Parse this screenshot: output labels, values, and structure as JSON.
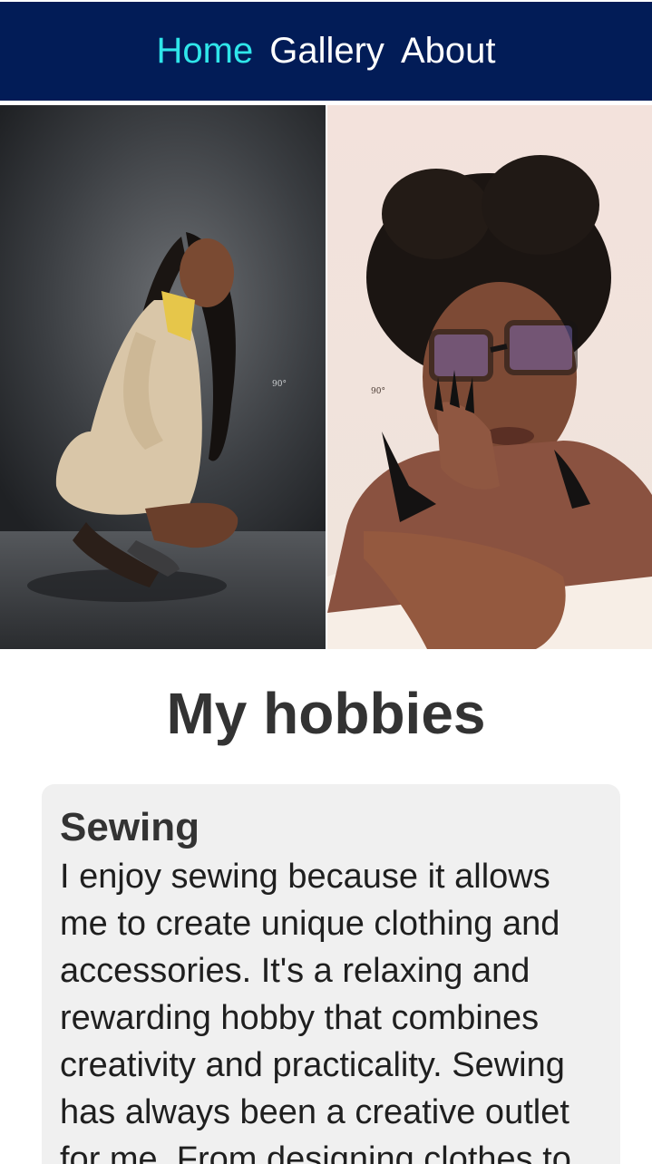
{
  "nav": {
    "items": [
      {
        "label": "Home",
        "active": true
      },
      {
        "label": "Gallery",
        "active": false
      },
      {
        "label": "About",
        "active": false
      }
    ]
  },
  "gallery": {
    "photos": [
      {
        "watermark": "90°"
      },
      {
        "watermark": "90°"
      }
    ]
  },
  "hobbies": {
    "title": "My hobbies",
    "cards": [
      {
        "heading": "Sewing",
        "text": "I enjoy sewing because it allows me to create unique clothing and accessories. It's a relaxing and rewarding hobby that combines creativity and practicality. Sewing has always been a creative outlet for me. From designing clothes to"
      }
    ]
  },
  "colors": {
    "nav_background": "#021c57",
    "nav_active": "#2fe6ea",
    "nav_text": "#ffffff",
    "card_background": "#f0f0f0",
    "title_text": "#333333"
  }
}
